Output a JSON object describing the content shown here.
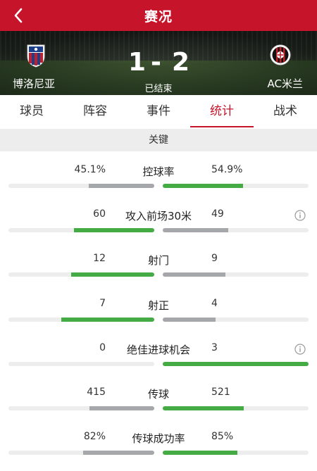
{
  "header": {
    "title": "赛况",
    "back_icon": "chevron-left-icon"
  },
  "match": {
    "home_team": "博洛尼亚",
    "away_team": "AC米兰",
    "home_score": "1",
    "separator": "-",
    "away_score": "2",
    "status": "已结束"
  },
  "tabs": [
    {
      "label": "球员",
      "active": false
    },
    {
      "label": "阵容",
      "active": false
    },
    {
      "label": "事件",
      "active": false
    },
    {
      "label": "统计",
      "active": true
    },
    {
      "label": "战术",
      "active": false
    }
  ],
  "section": {
    "title": "关键"
  },
  "colors": {
    "accent": "#c6142a",
    "bar_win": "#44ab45",
    "bar_lose": "#a6a7ab",
    "bar_track": "#ededed"
  },
  "stats": [
    {
      "label": "控球率",
      "home": "45.1%",
      "away": "54.9%",
      "home_ratio": 0.451,
      "away_ratio": 0.549,
      "info": false
    },
    {
      "label": "攻入前场30米",
      "home": "60",
      "away": "49",
      "home_ratio": 0.55,
      "away_ratio": 0.45,
      "info": true
    },
    {
      "label": "射门",
      "home": "12",
      "away": "9",
      "home_ratio": 0.571,
      "away_ratio": 0.429,
      "info": false
    },
    {
      "label": "射正",
      "home": "7",
      "away": "4",
      "home_ratio": 0.636,
      "away_ratio": 0.364,
      "info": false
    },
    {
      "label": "绝佳进球机会",
      "home": "0",
      "away": "3",
      "home_ratio": 0.0,
      "away_ratio": 1.0,
      "info": true
    },
    {
      "label": "传球",
      "home": "415",
      "away": "521",
      "home_ratio": 0.443,
      "away_ratio": 0.557,
      "info": false
    },
    {
      "label": "传球成功率",
      "home": "82%",
      "away": "85%",
      "home_ratio": 0.49,
      "away_ratio": 0.51,
      "info": false
    }
  ]
}
